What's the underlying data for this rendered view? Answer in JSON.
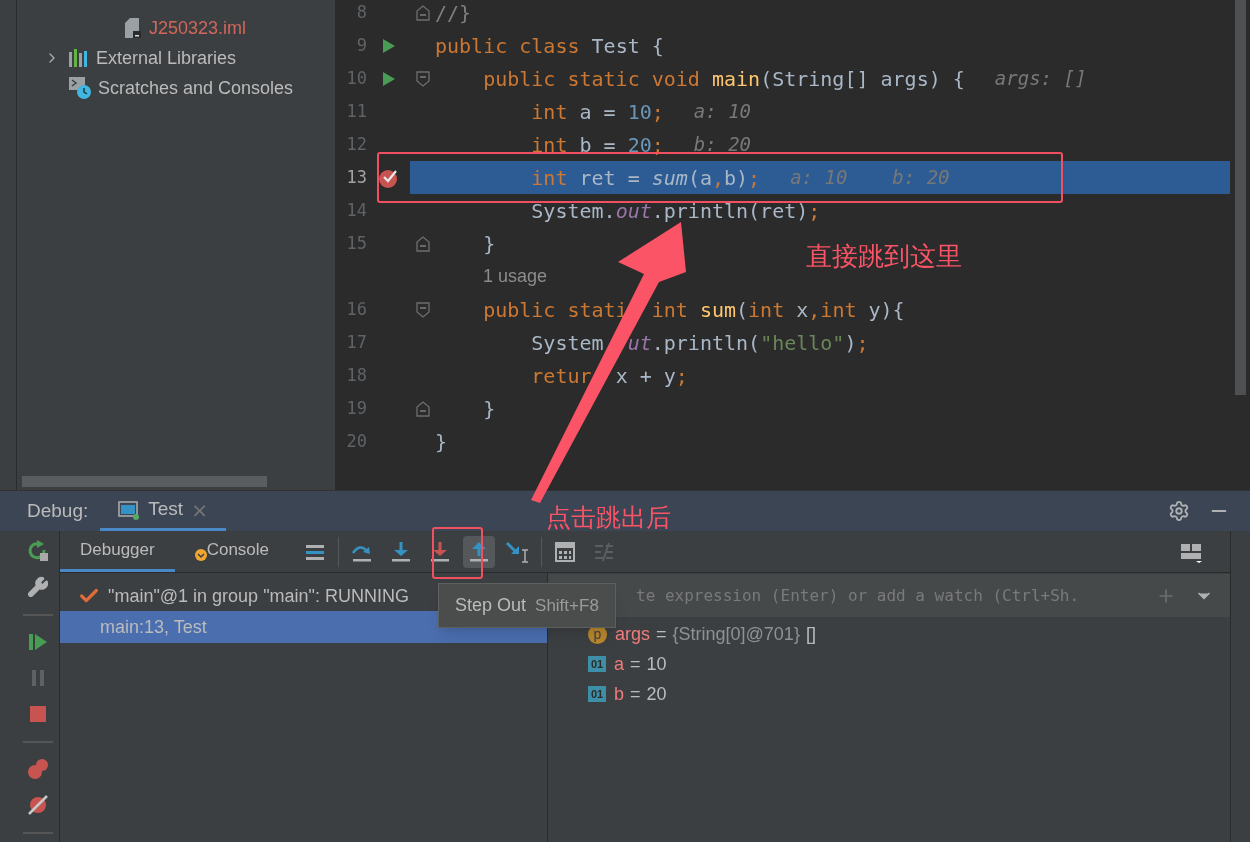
{
  "project_tree": [
    {
      "children": [
        {
          "label": "J250323.iml",
          "kind": "iml",
          "has_children": false
        }
      ]
    },
    {
      "label": "External Libraries",
      "kind": "libraries",
      "has_children": true
    },
    {
      "label": "Scratches and Consoles",
      "kind": "scratches",
      "has_children": false
    }
  ],
  "editor": {
    "lines": [
      {
        "kind": "code",
        "number": "8",
        "current": false,
        "fold_marker": {
          "kind": "end"
        },
        "tokens": [
          {
            "text": "//}",
            "kind": "comment"
          }
        ]
      },
      {
        "kind": "code",
        "number": "9",
        "current": false,
        "gutter_icon": {
          "kind": "run"
        },
        "tokens": [
          {
            "text": "public class ",
            "kind": "keyword"
          },
          {
            "text": "Test {",
            "kind": "plain"
          }
        ]
      },
      {
        "kind": "code",
        "number": "10",
        "current": false,
        "gutter_icon": {
          "kind": "run"
        },
        "fold_marker": {
          "kind": "start"
        },
        "tokens": [
          {
            "text": "    public static void ",
            "kind": "keyword"
          },
          {
            "text": "main",
            "kind": "method"
          },
          {
            "text": "(String[] args) {",
            "kind": "plain"
          }
        ],
        "hints": [
          "args: []"
        ]
      },
      {
        "kind": "code",
        "number": "11",
        "current": false,
        "tokens": [
          {
            "text": "        int ",
            "kind": "keyword"
          },
          {
            "text": "a = ",
            "kind": "plain"
          },
          {
            "text": "10",
            "kind": "number"
          },
          {
            "text": ";",
            "kind": "keyword"
          }
        ],
        "hints": [
          "a: 10"
        ]
      },
      {
        "kind": "code",
        "number": "12",
        "current": false,
        "tokens": [
          {
            "text": "        int ",
            "kind": "keyword"
          },
          {
            "text": "b = ",
            "kind": "plain"
          },
          {
            "text": "20",
            "kind": "number"
          },
          {
            "text": ";",
            "kind": "keyword"
          }
        ],
        "hints": [
          "b: 20"
        ]
      },
      {
        "kind": "code",
        "number": "13",
        "current": true,
        "gutter_icon": {
          "kind": "breakpoint"
        },
        "tokens": [
          {
            "text": "        int ",
            "kind": "keyword"
          },
          {
            "text": "ret = ",
            "kind": "plain"
          },
          {
            "text": "sum",
            "kind": "static_call"
          },
          {
            "text": "(a",
            "kind": "plain"
          },
          {
            "text": ",",
            "kind": "keyword"
          },
          {
            "text": "b)",
            "kind": "plain"
          },
          {
            "text": ";",
            "kind": "keyword"
          }
        ],
        "hints": [
          "a: 10",
          "b: 20"
        ]
      },
      {
        "kind": "code",
        "number": "14",
        "current": false,
        "tokens": [
          {
            "text": "        System.",
            "kind": "plain"
          },
          {
            "text": "out",
            "kind": "field"
          },
          {
            "text": ".println(ret)",
            "kind": "plain"
          },
          {
            "text": ";",
            "kind": "keyword"
          }
        ]
      },
      {
        "kind": "code",
        "number": "15",
        "current": false,
        "fold_marker": {
          "kind": "end"
        },
        "tokens": [
          {
            "text": "    }",
            "kind": "plain"
          }
        ]
      },
      {
        "kind": "usage",
        "text": "1 usage"
      },
      {
        "kind": "code",
        "number": "16",
        "current": false,
        "fold_marker": {
          "kind": "start"
        },
        "tokens": [
          {
            "text": "    public stati",
            "kind": "keyword",
            "covered_after": true
          },
          {
            "text": "int ",
            "kind": "keyword"
          },
          {
            "text": "sum",
            "kind": "method"
          },
          {
            "text": "(",
            "kind": "plain"
          },
          {
            "text": "int ",
            "kind": "keyword"
          },
          {
            "text": "x",
            "kind": "plain"
          },
          {
            "text": ",",
            "kind": "keyword"
          },
          {
            "text": "int ",
            "kind": "keyword"
          },
          {
            "text": "y){",
            "kind": "plain"
          }
        ]
      },
      {
        "kind": "code",
        "number": "17",
        "current": false,
        "tokens": [
          {
            "text": "        System",
            "kind": "plain",
            "covered_after": true
          },
          {
            "text": "ut",
            "kind": "field"
          },
          {
            "text": ".println(",
            "kind": "plain"
          },
          {
            "text": "\"hello\"",
            "kind": "string"
          },
          {
            "text": ")",
            "kind": "plain"
          },
          {
            "text": ";",
            "kind": "keyword"
          }
        ]
      },
      {
        "kind": "code",
        "number": "18",
        "current": false,
        "tokens": [
          {
            "text": "        retur",
            "kind": "keyword",
            "covered_after": true
          },
          {
            "text": "x + y",
            "kind": "plain"
          },
          {
            "text": ";",
            "kind": "keyword"
          }
        ]
      },
      {
        "kind": "code",
        "number": "19",
        "current": false,
        "fold_marker": {
          "kind": "end"
        },
        "tokens": [
          {
            "text": "    }",
            "kind": "plain"
          }
        ]
      },
      {
        "kind": "code",
        "number": "20",
        "current": false,
        "tokens": [
          {
            "text": "}",
            "kind": "plain"
          }
        ]
      }
    ]
  },
  "debug": {
    "label": "Debug:",
    "tabs": [
      {
        "label": "Test",
        "close": "×",
        "selected": true
      }
    ],
    "side_tools": [
      {
        "kind": "rerun",
        "disabled": false
      },
      {
        "kind": "settings",
        "disabled": false
      },
      {
        "kind": "separator"
      },
      {
        "kind": "resume",
        "disabled": false
      },
      {
        "kind": "pause",
        "disabled": true
      },
      {
        "kind": "stop",
        "disabled": false
      },
      {
        "kind": "separator"
      },
      {
        "kind": "breakpoints",
        "disabled": false
      },
      {
        "kind": "mute",
        "disabled": false
      },
      {
        "kind": "separator"
      }
    ],
    "inner_tabs": [
      {
        "label": "Debugger",
        "selected": true,
        "badge": false
      },
      {
        "label": "Console",
        "selected": false,
        "badge": true
      }
    ],
    "toolbar": [
      {
        "kind": "layout",
        "hovered": false
      },
      {
        "kind": "separator"
      },
      {
        "kind": "step_over",
        "hovered": false
      },
      {
        "kind": "step_into",
        "hovered": false
      },
      {
        "kind": "force_step_into",
        "hovered": false
      },
      {
        "kind": "step_out",
        "hovered": true
      },
      {
        "kind": "run_to_cursor",
        "hovered": false
      },
      {
        "kind": "separator"
      },
      {
        "kind": "evaluate",
        "hovered": false
      },
      {
        "kind": "trace",
        "hovered": false
      }
    ],
    "thread": "\"main\"@1 in group \"main\": RUNNING",
    "frames": [
      {
        "label": "main:13, Test",
        "selected": true
      }
    ],
    "watch_placeholder": "te expression (Enter) or add a watch (Ctrl+Sh.",
    "variables": [
      {
        "badge": "p",
        "kind": "param",
        "name": "args",
        "separator": "=",
        "value": "{String[0]@701}",
        "extra": "[]"
      },
      {
        "badge": "01",
        "kind": "primitive",
        "name": "a",
        "separator": "=",
        "value": "10"
      },
      {
        "badge": "01",
        "kind": "primitive",
        "name": "b",
        "separator": "=",
        "value": "20"
      }
    ],
    "tooltip": {
      "title": "Step Out",
      "shortcut": "Shift+F8"
    }
  },
  "annotations": [
    {
      "text": "直接跳到这里"
    },
    {
      "text": "点击跳出后"
    }
  ]
}
